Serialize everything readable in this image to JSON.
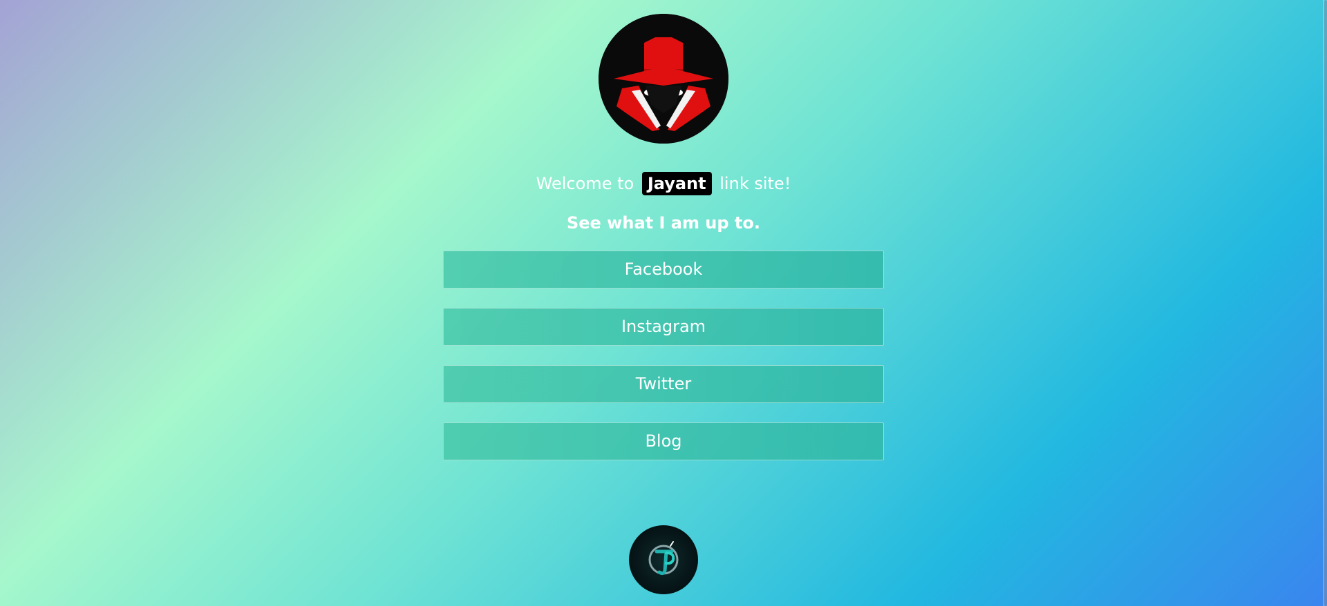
{
  "profile": {
    "avatar_icon": "spy-hat-icon",
    "welcome_prefix": "Welcome to",
    "name": "Jayant",
    "welcome_suffix": "link site!",
    "subtitle": "See what I am up to."
  },
  "links": [
    {
      "label": "Facebook"
    },
    {
      "label": "Instagram"
    },
    {
      "label": "Twitter"
    },
    {
      "label": "Blog"
    }
  ],
  "footer": {
    "logo_icon": "jp-monogram-icon"
  },
  "colors": {
    "accent_red": "#e01010",
    "badge_bg": "#000000",
    "button_bg": "#44c3b0"
  }
}
